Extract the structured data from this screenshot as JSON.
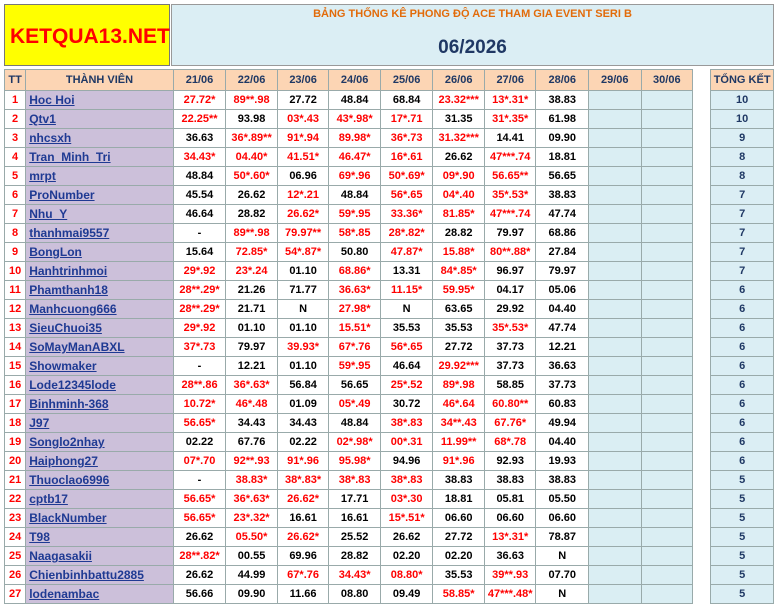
{
  "logo": "KETQUA13.NET",
  "banner": {
    "title": "BẢNG THỐNG KÊ PHONG ĐỘ ACE THAM GIA EVENT SERI B",
    "month": "06/2026"
  },
  "columns": {
    "tt": "TT",
    "member": "THÀNH VIÊN",
    "dates": [
      "21/06",
      "22/06",
      "23/06",
      "24/06",
      "25/06",
      "26/06",
      "27/06",
      "28/06",
      "29/06",
      "30/06"
    ],
    "total": "TỔNG KẾT"
  },
  "rows": [
    {
      "tt": "1",
      "name": "Hoc Hoi",
      "cells": [
        {
          "v": "27.72*",
          "r": true
        },
        {
          "v": "89**.98",
          "r": true
        },
        {
          "v": "27.72",
          "r": false
        },
        {
          "v": "48.84",
          "r": false
        },
        {
          "v": "68.84",
          "r": false
        },
        {
          "v": "23.32***",
          "r": true
        },
        {
          "v": "13*.31*",
          "r": true
        },
        {
          "v": "38.83",
          "r": false
        }
      ],
      "total": "10"
    },
    {
      "tt": "2",
      "name": "Qtv1",
      "cells": [
        {
          "v": "22.25**",
          "r": true
        },
        {
          "v": "93.98",
          "r": false
        },
        {
          "v": "03*.43",
          "r": true
        },
        {
          "v": "43*.98*",
          "r": true
        },
        {
          "v": "17*.71",
          "r": true
        },
        {
          "v": "31.35",
          "r": false
        },
        {
          "v": "31*.35*",
          "r": true
        },
        {
          "v": "61.98",
          "r": false
        }
      ],
      "total": "10"
    },
    {
      "tt": "3",
      "name": "nhcsxh",
      "cells": [
        {
          "v": "36.63",
          "r": false
        },
        {
          "v": "36*.89**",
          "r": true
        },
        {
          "v": "91*.94",
          "r": true
        },
        {
          "v": "89.98*",
          "r": true
        },
        {
          "v": "36*.73",
          "r": true
        },
        {
          "v": "31.32***",
          "r": true
        },
        {
          "v": "14.41",
          "r": false
        },
        {
          "v": "09.90",
          "r": false
        }
      ],
      "total": "9"
    },
    {
      "tt": "4",
      "name": "Tran_Minh_Tri",
      "cells": [
        {
          "v": "34.43*",
          "r": true
        },
        {
          "v": "04.40*",
          "r": true
        },
        {
          "v": "41.51*",
          "r": true
        },
        {
          "v": "46.47*",
          "r": true
        },
        {
          "v": "16*.61",
          "r": true
        },
        {
          "v": "26.62",
          "r": false
        },
        {
          "v": "47***.74",
          "r": true
        },
        {
          "v": "18.81",
          "r": false
        }
      ],
      "total": "8"
    },
    {
      "tt": "5",
      "name": "mrpt",
      "cells": [
        {
          "v": "48.84",
          "r": false
        },
        {
          "v": "50*.60*",
          "r": true
        },
        {
          "v": "06.96",
          "r": false
        },
        {
          "v": "69*.96",
          "r": true
        },
        {
          "v": "50*.69*",
          "r": true
        },
        {
          "v": "09*.90",
          "r": true
        },
        {
          "v": "56.65**",
          "r": true
        },
        {
          "v": "56.65",
          "r": false
        }
      ],
      "total": "8"
    },
    {
      "tt": "6",
      "name": "ProNumber",
      "cells": [
        {
          "v": "45.54",
          "r": false
        },
        {
          "v": "26.62",
          "r": false
        },
        {
          "v": "12*.21",
          "r": true
        },
        {
          "v": "48.84",
          "r": false
        },
        {
          "v": "56*.65",
          "r": true
        },
        {
          "v": "04*.40",
          "r": true
        },
        {
          "v": "35*.53*",
          "r": true
        },
        {
          "v": "38.83",
          "r": false
        }
      ],
      "total": "7"
    },
    {
      "tt": "7",
      "name": "Nhu_Y",
      "cells": [
        {
          "v": "46.64",
          "r": false
        },
        {
          "v": "28.82",
          "r": false
        },
        {
          "v": "26.62*",
          "r": true
        },
        {
          "v": "59*.95",
          "r": true
        },
        {
          "v": "33.36*",
          "r": true
        },
        {
          "v": "81.85*",
          "r": true
        },
        {
          "v": "47***.74",
          "r": true
        },
        {
          "v": "47.74",
          "r": false
        }
      ],
      "total": "7"
    },
    {
      "tt": "8",
      "name": "thanhmai9557",
      "cells": [
        {
          "v": "-",
          "r": false
        },
        {
          "v": "89**.98",
          "r": true
        },
        {
          "v": "79.97**",
          "r": true
        },
        {
          "v": "58*.85",
          "r": true
        },
        {
          "v": "28*.82*",
          "r": true
        },
        {
          "v": "28.82",
          "r": false
        },
        {
          "v": "79.97",
          "r": false
        },
        {
          "v": "68.86",
          "r": false
        }
      ],
      "total": "7"
    },
    {
      "tt": "9",
      "name": "BongLon",
      "cells": [
        {
          "v": "15.64",
          "r": false
        },
        {
          "v": "72.85*",
          "r": true
        },
        {
          "v": "54*.87*",
          "r": true
        },
        {
          "v": "50.80",
          "r": false
        },
        {
          "v": "47.87*",
          "r": true
        },
        {
          "v": "15.88*",
          "r": true
        },
        {
          "v": "80**.88*",
          "r": true
        },
        {
          "v": "27.84",
          "r": false
        }
      ],
      "total": "7"
    },
    {
      "tt": "10",
      "name": "Hanhtrinhmoi",
      "cells": [
        {
          "v": "29*.92",
          "r": true
        },
        {
          "v": "23*.24",
          "r": true
        },
        {
          "v": "01.10",
          "r": false
        },
        {
          "v": "68.86*",
          "r": true
        },
        {
          "v": "13.31",
          "r": false
        },
        {
          "v": "84*.85*",
          "r": true
        },
        {
          "v": "96.97",
          "r": false
        },
        {
          "v": "79.97",
          "r": false
        }
      ],
      "total": "7"
    },
    {
      "tt": "11",
      "name": "Phamthanh18",
      "cells": [
        {
          "v": "28**.29*",
          "r": true
        },
        {
          "v": "21.26",
          "r": false
        },
        {
          "v": "71.77",
          "r": false
        },
        {
          "v": "36.63*",
          "r": true
        },
        {
          "v": "11.15*",
          "r": true
        },
        {
          "v": "59.95*",
          "r": true
        },
        {
          "v": "04.17",
          "r": false
        },
        {
          "v": "05.06",
          "r": false
        }
      ],
      "total": "6"
    },
    {
      "tt": "12",
      "name": "Manhcuong666",
      "cells": [
        {
          "v": "28**.29*",
          "r": true
        },
        {
          "v": "21.71",
          "r": false
        },
        {
          "v": "N",
          "r": false
        },
        {
          "v": "27.98*",
          "r": true
        },
        {
          "v": "N",
          "r": false
        },
        {
          "v": "63.65",
          "r": false
        },
        {
          "v": "29.92",
          "r": false
        },
        {
          "v": "04.40",
          "r": false
        }
      ],
      "total": "6"
    },
    {
      "tt": "13",
      "name": "SieuChuoi35",
      "cells": [
        {
          "v": "29*.92",
          "r": true
        },
        {
          "v": "01.10",
          "r": false
        },
        {
          "v": "01.10",
          "r": false
        },
        {
          "v": "15.51*",
          "r": true
        },
        {
          "v": "35.53",
          "r": false
        },
        {
          "v": "35.53",
          "r": false
        },
        {
          "v": "35*.53*",
          "r": true
        },
        {
          "v": "47.74",
          "r": false
        }
      ],
      "total": "6"
    },
    {
      "tt": "14",
      "name": "SoMayManABXL",
      "cells": [
        {
          "v": "37*.73",
          "r": true
        },
        {
          "v": "79.97",
          "r": false
        },
        {
          "v": "39.93*",
          "r": true
        },
        {
          "v": "67*.76",
          "r": true
        },
        {
          "v": "56*.65",
          "r": true
        },
        {
          "v": "27.72",
          "r": false
        },
        {
          "v": "37.73",
          "r": false
        },
        {
          "v": "12.21",
          "r": false
        }
      ],
      "total": "6"
    },
    {
      "tt": "15",
      "name": "Showmaker",
      "cells": [
        {
          "v": "-",
          "r": false
        },
        {
          "v": "12.21",
          "r": false
        },
        {
          "v": "01.10",
          "r": false
        },
        {
          "v": "59*.95",
          "r": true
        },
        {
          "v": "46.64",
          "r": false
        },
        {
          "v": "29.92***",
          "r": true
        },
        {
          "v": "37.73",
          "r": false
        },
        {
          "v": "36.63",
          "r": false
        }
      ],
      "total": "6"
    },
    {
      "tt": "16",
      "name": "Lode12345lode",
      "cells": [
        {
          "v": "28**.86",
          "r": true
        },
        {
          "v": "36*.63*",
          "r": true
        },
        {
          "v": "56.84",
          "r": false
        },
        {
          "v": "56.65",
          "r": false
        },
        {
          "v": "25*.52",
          "r": true
        },
        {
          "v": "89*.98",
          "r": true
        },
        {
          "v": "58.85",
          "r": false
        },
        {
          "v": "37.73",
          "r": false
        }
      ],
      "total": "6"
    },
    {
      "tt": "17",
      "name": "Binhminh-368",
      "cells": [
        {
          "v": "10.72*",
          "r": true
        },
        {
          "v": "46*.48",
          "r": true
        },
        {
          "v": "01.09",
          "r": false
        },
        {
          "v": "05*.49",
          "r": true
        },
        {
          "v": "30.72",
          "r": false
        },
        {
          "v": "46*.64",
          "r": true
        },
        {
          "v": "60.80**",
          "r": true
        },
        {
          "v": "60.83",
          "r": false
        }
      ],
      "total": "6"
    },
    {
      "tt": "18",
      "name": "J97",
      "cells": [
        {
          "v": "56.65*",
          "r": true
        },
        {
          "v": "34.43",
          "r": false
        },
        {
          "v": "34.43",
          "r": false
        },
        {
          "v": "48.84",
          "r": false
        },
        {
          "v": "38*.83",
          "r": true
        },
        {
          "v": "34**.43",
          "r": true
        },
        {
          "v": "67.76*",
          "r": true
        },
        {
          "v": "49.94",
          "r": false
        }
      ],
      "total": "6"
    },
    {
      "tt": "19",
      "name": "Songlo2nhay",
      "cells": [
        {
          "v": "02.22",
          "r": false
        },
        {
          "v": "67.76",
          "r": false
        },
        {
          "v": "02.22",
          "r": false
        },
        {
          "v": "02*.98*",
          "r": true
        },
        {
          "v": "00*.31",
          "r": true
        },
        {
          "v": "11.99**",
          "r": true
        },
        {
          "v": "68*.78",
          "r": true
        },
        {
          "v": "04.40",
          "r": false
        }
      ],
      "total": "6"
    },
    {
      "tt": "20",
      "name": "Haiphong27",
      "cells": [
        {
          "v": "07*.70",
          "r": true
        },
        {
          "v": "92**.93",
          "r": true
        },
        {
          "v": "91*.96",
          "r": true
        },
        {
          "v": "95.98*",
          "r": true
        },
        {
          "v": "94.96",
          "r": false
        },
        {
          "v": "91*.96",
          "r": true
        },
        {
          "v": "92.93",
          "r": false
        },
        {
          "v": "19.93",
          "r": false
        }
      ],
      "total": "6"
    },
    {
      "tt": "21",
      "name": "Thuoclao6996",
      "cells": [
        {
          "v": "-",
          "r": false
        },
        {
          "v": "38.83*",
          "r": true
        },
        {
          "v": "38*.83*",
          "r": true
        },
        {
          "v": "38*.83",
          "r": true
        },
        {
          "v": "38*.83",
          "r": true
        },
        {
          "v": "38.83",
          "r": false
        },
        {
          "v": "38.83",
          "r": false
        },
        {
          "v": "38.83",
          "r": false
        }
      ],
      "total": "5"
    },
    {
      "tt": "22",
      "name": "cptb17",
      "cells": [
        {
          "v": "56.65*",
          "r": true
        },
        {
          "v": "36*.63*",
          "r": true
        },
        {
          "v": "26.62*",
          "r": true
        },
        {
          "v": "17.71",
          "r": false
        },
        {
          "v": "03*.30",
          "r": true
        },
        {
          "v": "18.81",
          "r": false
        },
        {
          "v": "05.81",
          "r": false
        },
        {
          "v": "05.50",
          "r": false
        }
      ],
      "total": "5"
    },
    {
      "tt": "23",
      "name": "BlackNumber",
      "cells": [
        {
          "v": "56.65*",
          "r": true
        },
        {
          "v": "23*.32*",
          "r": true
        },
        {
          "v": "16.61",
          "r": false
        },
        {
          "v": "16.61",
          "r": false
        },
        {
          "v": "15*.51*",
          "r": true
        },
        {
          "v": "06.60",
          "r": false
        },
        {
          "v": "06.60",
          "r": false
        },
        {
          "v": "06.60",
          "r": false
        }
      ],
      "total": "5"
    },
    {
      "tt": "24",
      "name": "T98",
      "cells": [
        {
          "v": "26.62",
          "r": false
        },
        {
          "v": "05.50*",
          "r": true
        },
        {
          "v": "26.62*",
          "r": true
        },
        {
          "v": "25.52",
          "r": false
        },
        {
          "v": "26.62",
          "r": false
        },
        {
          "v": "27.72",
          "r": false
        },
        {
          "v": "13*.31*",
          "r": true
        },
        {
          "v": "78.87",
          "r": false
        }
      ],
      "total": "5"
    },
    {
      "tt": "25",
      "name": "Naagasakii",
      "cells": [
        {
          "v": "28**.82*",
          "r": true
        },
        {
          "v": "00.55",
          "r": false
        },
        {
          "v": "69.96",
          "r": false
        },
        {
          "v": "28.82",
          "r": false
        },
        {
          "v": "02.20",
          "r": false
        },
        {
          "v": "02.20",
          "r": false
        },
        {
          "v": "36.63",
          "r": false
        },
        {
          "v": "N",
          "r": false
        }
      ],
      "total": "5"
    },
    {
      "tt": "26",
      "name": "Chienbinhbattu2885",
      "cells": [
        {
          "v": "26.62",
          "r": false
        },
        {
          "v": "44.99",
          "r": false
        },
        {
          "v": "67*.76",
          "r": true
        },
        {
          "v": "34.43*",
          "r": true
        },
        {
          "v": "08.80*",
          "r": true
        },
        {
          "v": "35.53",
          "r": false
        },
        {
          "v": "39**.93",
          "r": true
        },
        {
          "v": "07.70",
          "r": false
        }
      ],
      "total": "5"
    },
    {
      "tt": "27",
      "name": "lodenambac",
      "cells": [
        {
          "v": "56.66",
          "r": false
        },
        {
          "v": "09.90",
          "r": false
        },
        {
          "v": "11.66",
          "r": false
        },
        {
          "v": "08.80",
          "r": false
        },
        {
          "v": "09.49",
          "r": false
        },
        {
          "v": "58.85*",
          "r": true
        },
        {
          "v": "47***.48*",
          "r": true
        },
        {
          "v": "N",
          "r": false
        }
      ],
      "total": "5"
    }
  ]
}
